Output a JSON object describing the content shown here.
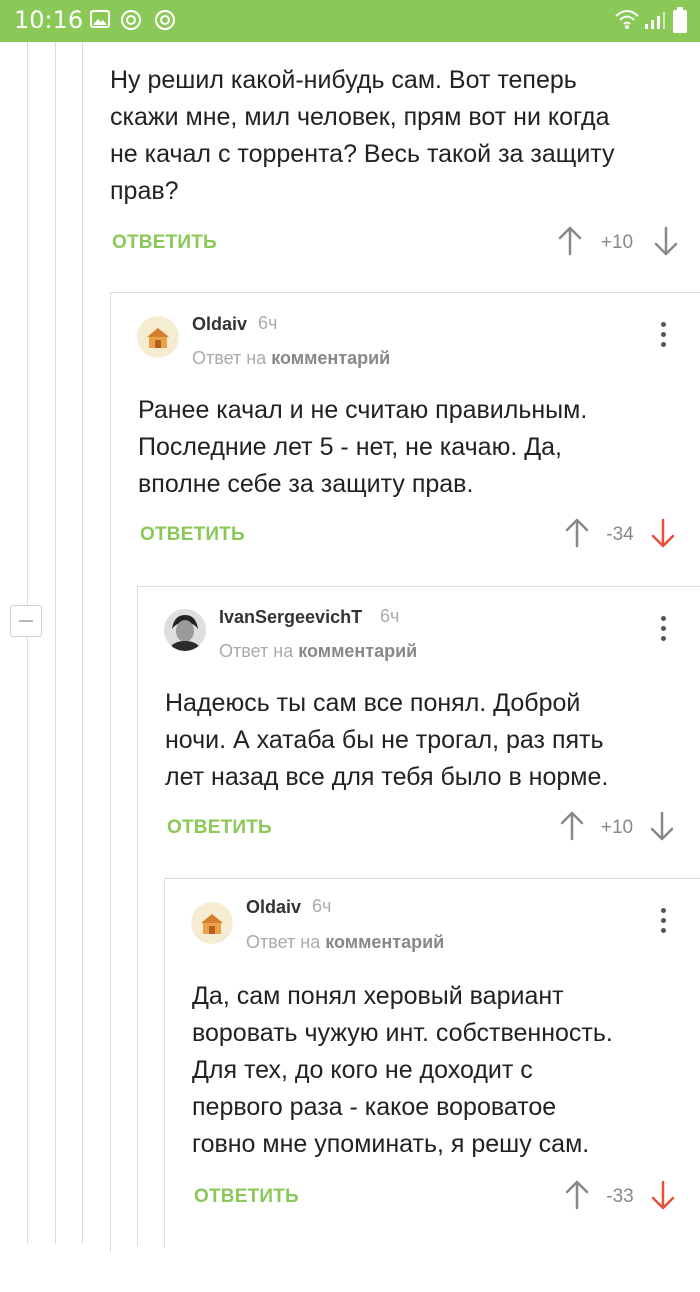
{
  "status_bar": {
    "time": "10:16"
  },
  "comments": [
    {
      "text": "Ну решил какой-нибудь сам. Вот теперь\nскажи мне, мил человек, прям вот ни когда\nне качал с торрента? Весь такой за защиту\nправ?",
      "reply_label": "ОТВЕТИТЬ",
      "score": "+10"
    },
    {
      "username": "Oldaiv",
      "time_ago": "6ч",
      "reply_to_prefix": "Ответ на",
      "reply_to_link": "комментарий",
      "text": "Ранее качал и не считаю правильным.\nПоследние лет 5 - нет, не качаю. Да,\nвполне себе за защиту прав.",
      "reply_label": "ОТВЕТИТЬ",
      "score": "-34"
    },
    {
      "username": "IvanSergeevichT",
      "time_ago": "6ч",
      "reply_to_prefix": "Ответ на",
      "reply_to_link": "комментарий",
      "text": "Надеюсь ты сам все понял. Доброй\nночи. А хатаба бы не трогал, раз пять\nлет назад все для тебя было в норме.",
      "reply_label": "ОТВЕТИТЬ",
      "score": "+10"
    },
    {
      "username": "Oldaiv",
      "time_ago": "6ч",
      "reply_to_prefix": "Ответ на",
      "reply_to_link": "комментарий",
      "text": "Да, сам понял херовый вариант\nвоvровать чужую инт. собственность.\nДля тех, до кого не доходит с\nпервого раза - какое вороватое\nговно мне упоминать, я решу сам.",
      "reply_label": "ОТВЕТИТЬ",
      "score": "-33"
    }
  ],
  "colors": {
    "accent": "#8ac858",
    "downvote_active": "#e8503a",
    "neutral": "#888888"
  }
}
